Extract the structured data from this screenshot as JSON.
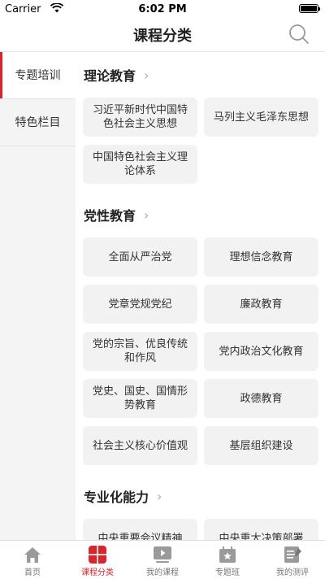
{
  "status": {
    "carrier": "Carrier",
    "time": "6:02 PM"
  },
  "nav": {
    "title": "课程分类"
  },
  "sidebar": {
    "items": [
      {
        "label": "专题培训"
      },
      {
        "label": "特色栏目"
      }
    ]
  },
  "sections": [
    {
      "title": "理论教育",
      "items": [
        "习近平新时代中国特色社会主义思想",
        "马列主义毛泽东思想",
        "中国特色社会主义理论体系"
      ]
    },
    {
      "title": "党性教育",
      "items": [
        "全面从严治党",
        "理想信念教育",
        "党章党规党纪",
        "廉政教育",
        "党的宗旨、优良传统和作风",
        "党内政治文化教育",
        "党史、国史、国情形势教育",
        "政德教育",
        "社会主义核心价值观",
        "基层组织建设"
      ]
    },
    {
      "title": "专业化能力",
      "items": [
        "中央重要会议精神",
        "中央重大决策部署"
      ]
    }
  ],
  "tabs": [
    {
      "label": "首页"
    },
    {
      "label": "课程分类"
    },
    {
      "label": "我的课程"
    },
    {
      "label": "专题班"
    },
    {
      "label": "我的测评"
    }
  ],
  "colors": {
    "accent": "#d8262c",
    "chip_bg": "#f2f2f2",
    "sidebar_bg": "#f4f4f4"
  }
}
